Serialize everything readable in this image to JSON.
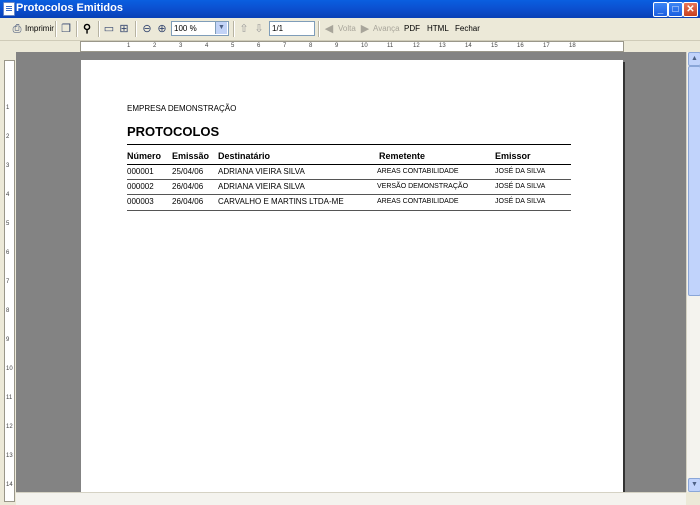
{
  "window": {
    "title": "Protocolos Emitidos"
  },
  "toolbar": {
    "print_label": "Imprimir",
    "zoom_value": "100 %",
    "page_value": "1/1",
    "back_label": "Volta",
    "forward_label": "Avança",
    "pdf_label": "PDF",
    "html_label": "HTML",
    "close_label": "Fechar"
  },
  "icons": [
    "print-icon",
    "copy-icon",
    "find-icon",
    "page-width-icon",
    "full-page-icon",
    "zoom-out-icon",
    "zoom-in-icon",
    "prev-page-icon",
    "next-page-icon",
    "back-icon",
    "forward-icon"
  ],
  "report": {
    "company": "EMPRESA DEMONSTRAÇÃO",
    "title": "PROTOCOLOS",
    "columns": [
      "Número",
      "Emissão",
      "Destinatário",
      "Remetente",
      "Emissor"
    ],
    "rows": [
      [
        "000001",
        "25/04/06",
        "ADRIANA VIEIRA SILVA",
        "AREAS CONTABILIDADE",
        "JOSÉ DA SILVA"
      ],
      [
        "000002",
        "26/04/06",
        "ADRIANA VIEIRA SILVA",
        "VERSÃO DEMONSTRAÇÃO",
        "JOSÉ DA SILVA"
      ],
      [
        "000003",
        "26/04/06",
        "CARVALHO E MARTINS LTDA-ME",
        "AREAS CONTABILIDADE",
        "JOSÉ DA SILVA"
      ]
    ]
  },
  "rulers": {
    "horizontal": [
      "1",
      "2",
      "3",
      "4",
      "5",
      "6",
      "7",
      "8",
      "9",
      "10",
      "11",
      "12",
      "13",
      "14",
      "15",
      "16",
      "17",
      "18"
    ],
    "vertical": [
      "1",
      "2",
      "3",
      "4",
      "5",
      "6",
      "7",
      "8",
      "9",
      "10",
      "11",
      "12",
      "13",
      "14"
    ]
  },
  "colors": {
    "titlebar": "#0b4fcf",
    "canvas": "#838383",
    "page": "#ffffff"
  }
}
